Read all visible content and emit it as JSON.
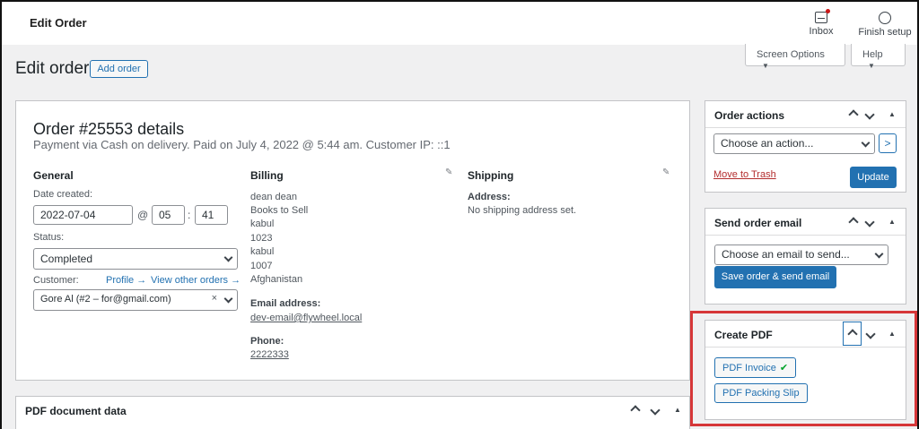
{
  "topbar": {
    "title": "Edit Order",
    "inbox_label": "Inbox",
    "finish_label": "Finish setup"
  },
  "screen_options": {
    "label": "Screen Options"
  },
  "help": {
    "label": "Help"
  },
  "page": {
    "title": "Edit order",
    "add_order_label": "Add order"
  },
  "order": {
    "title": "Order #25553 details",
    "subtitle": "Payment via Cash on delivery. Paid on July 4, 2022 @ 5:44 am. Customer IP: ::1",
    "general": {
      "heading": "General",
      "date_label": "Date created:",
      "date_value": "2022-07-04",
      "at": "@",
      "hour": "05",
      "colon": ":",
      "minute": "41",
      "status_label": "Status:",
      "status_value": "Completed",
      "customer_label": "Customer:",
      "profile_link": "Profile →",
      "other_orders_link": "View other orders →",
      "customer_value": "Gore Al (#2 – for@gmail.com)"
    },
    "billing": {
      "heading": "Billing",
      "address_lines": [
        "dean dean",
        "Books to Sell",
        "kabul",
        "1023",
        "kabul",
        "1007",
        "Afghanistan"
      ],
      "email_label": "Email address:",
      "email_value": "dev-email@flywheel.local",
      "phone_label": "Phone:",
      "phone_value": "2222333"
    },
    "shipping": {
      "heading": "Shipping",
      "address_label": "Address:",
      "address_value": "No shipping address set."
    }
  },
  "pdf_document_data": {
    "title": "PDF document data"
  },
  "order_actions": {
    "title": "Order actions",
    "select_value": "Choose an action...",
    "go_label": ">",
    "trash_label": "Move to Trash",
    "update_label": "Update"
  },
  "send_email": {
    "title": "Send order email",
    "select_value": "Choose an email to send...",
    "save_send_label": "Save order & send email"
  },
  "create_pdf": {
    "title": "Create PDF",
    "invoice_label": "PDF Invoice",
    "invoice_check": "✔",
    "packing_slip_label": "PDF Packing Slip"
  },
  "colors": {
    "accent": "#2271b1",
    "highlight_border": "#d63638",
    "trash_link": "#b32d2e",
    "check": "#00a32a"
  }
}
